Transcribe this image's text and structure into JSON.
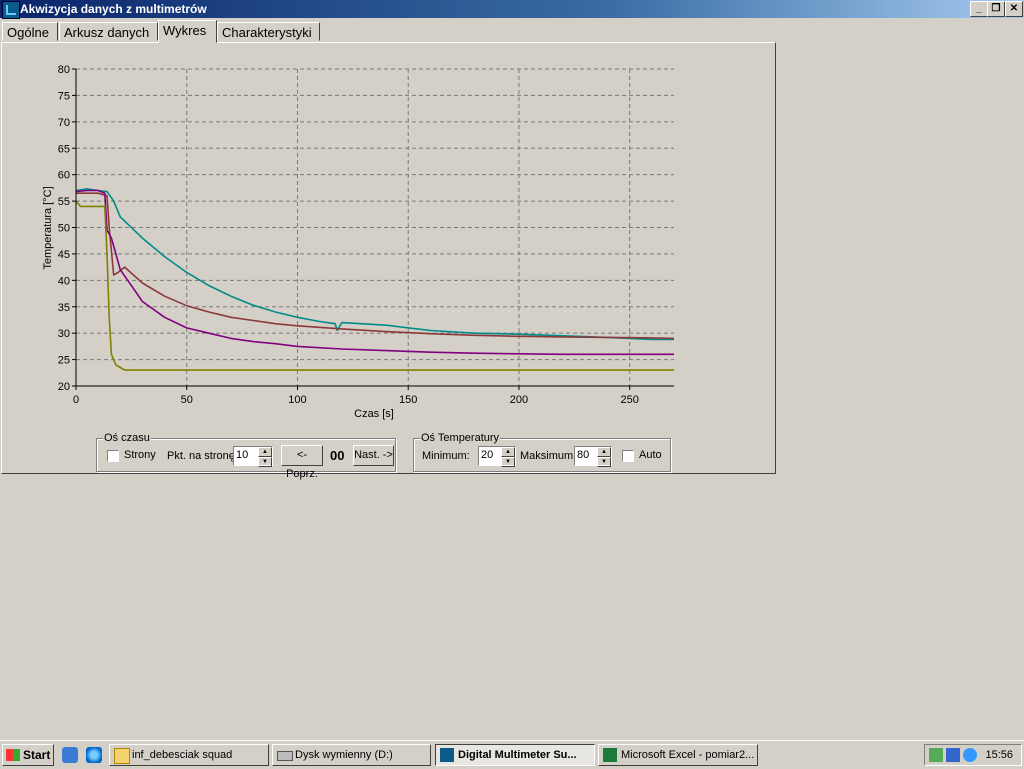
{
  "window": {
    "title": "Akwizycja danych z multimetrów"
  },
  "tabs": [
    {
      "label": "Ogólne"
    },
    {
      "label": "Arkusz danych"
    },
    {
      "label": "Wykres"
    },
    {
      "label": "Charakterystyki"
    }
  ],
  "chart_data": {
    "type": "line",
    "xlabel": "Czas [s]",
    "ylabel": "Temperatura [°C]",
    "xlim": [
      0,
      270
    ],
    "ylim": [
      20,
      80
    ],
    "xticks": [
      0,
      50,
      100,
      150,
      200,
      250
    ],
    "yticks": [
      20,
      25,
      30,
      35,
      40,
      45,
      50,
      55,
      60,
      65,
      70,
      75,
      80
    ],
    "grid": true,
    "series": [
      {
        "color": "#008b8b",
        "x": [
          0,
          5,
          10,
          14,
          17,
          20,
          30,
          40,
          50,
          60,
          70,
          80,
          90,
          100,
          110,
          117,
          118,
          120,
          140,
          160,
          180,
          200,
          220,
          240,
          250,
          260,
          270
        ],
        "y": [
          57,
          57.3,
          57,
          56.8,
          55,
          52,
          48,
          44.5,
          41.5,
          39,
          37,
          35.3,
          34,
          33,
          32.2,
          31.8,
          30.5,
          32,
          31.5,
          30.5,
          30,
          29.8,
          29.5,
          29.2,
          29,
          28.8,
          28.8
        ]
      },
      {
        "color": "#8b3a3a",
        "x": [
          0,
          5,
          10,
          14,
          15,
          17,
          19,
          22,
          30,
          40,
          50,
          60,
          70,
          80,
          90,
          100,
          120,
          140,
          160,
          180,
          200,
          220,
          240,
          260,
          270
        ],
        "y": [
          56.5,
          56.5,
          56.5,
          56,
          50,
          41,
          41.5,
          42.5,
          39.5,
          37,
          35.2,
          34,
          33,
          32.4,
          31.8,
          31.4,
          30.8,
          30.3,
          29.9,
          29.6,
          29.4,
          29.3,
          29.2,
          29.1,
          29
        ]
      },
      {
        "color": "#800080",
        "x": [
          0,
          5,
          10,
          13,
          14,
          16,
          18,
          20,
          25,
          30,
          40,
          50,
          60,
          70,
          80,
          90,
          100,
          120,
          140,
          160,
          180,
          200,
          220,
          240,
          260,
          270
        ],
        "y": [
          56.8,
          57,
          57,
          56.5,
          49.5,
          48,
          45,
          42,
          39,
          36,
          33,
          31,
          30,
          29,
          28.4,
          28,
          27.5,
          27,
          26.7,
          26.4,
          26.2,
          26.1,
          26,
          26,
          26,
          26
        ]
      },
      {
        "color": "#808000",
        "x": [
          0,
          2,
          5,
          10,
          13,
          14,
          15,
          16,
          18,
          20,
          22,
          30,
          50,
          100,
          150,
          200,
          250,
          270
        ],
        "y": [
          55,
          54,
          54,
          54,
          54,
          45,
          33,
          26,
          24,
          23.5,
          23,
          23,
          23,
          23,
          23,
          23,
          23,
          23
        ]
      }
    ]
  },
  "time_axis": {
    "group_title": "Oś czasu",
    "pages_label": "Strony",
    "points_label": "Pkt. na stronę",
    "points_value": "10",
    "prev_label": "<-Poprz.",
    "page_counter": "00",
    "next_label": "Nast. ->"
  },
  "temp_axis": {
    "group_title": "Oś Temperatury",
    "min_label": "Minimum:",
    "min_value": "20",
    "max_label": "Maksimum:",
    "max_value": "80",
    "auto_label": "Auto"
  },
  "taskbar": {
    "start_label": "Start",
    "tasks": [
      {
        "label": "inf_debesciak squad"
      },
      {
        "label": "Dysk wymienny (D:)"
      },
      {
        "label": "Digital Multimeter Su..."
      },
      {
        "label": "Microsoft Excel - pomiar2..."
      }
    ],
    "clock": "15:56"
  }
}
